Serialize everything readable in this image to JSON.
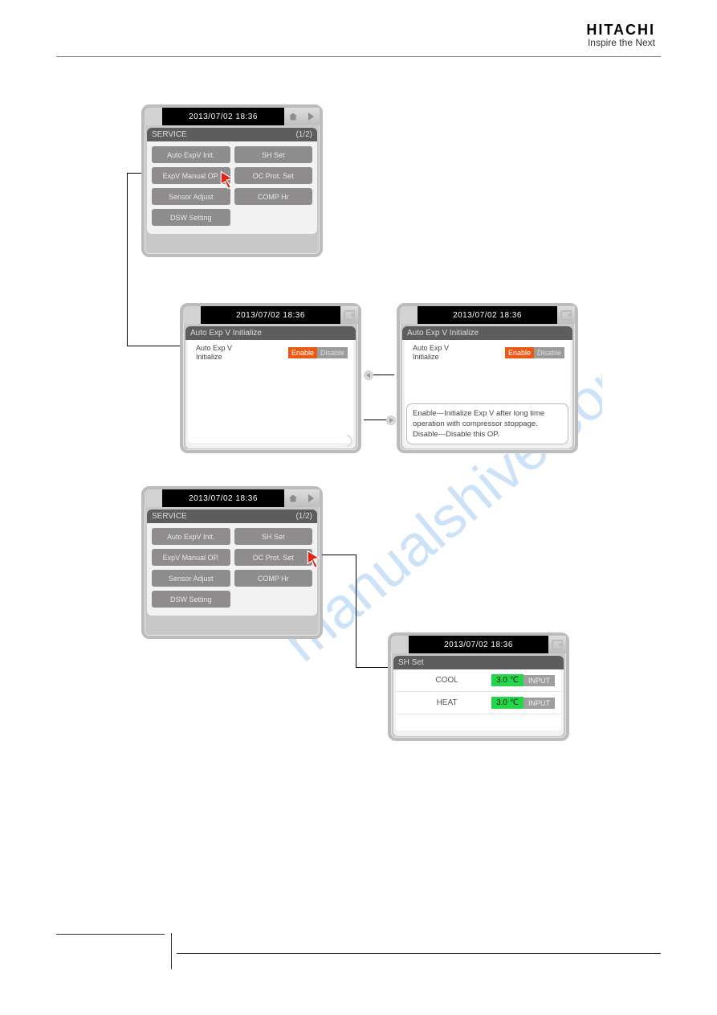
{
  "brand": {
    "logo": "HITACHI",
    "tagline": "Inspire the Next"
  },
  "watermark": "manualshive.com",
  "timestamp": "2013/07/02 18:36",
  "service_panel": {
    "title": "SERVICE",
    "page_indicator": "(1/2)",
    "buttons": [
      "Auto ExpV Init.",
      "SH Set",
      "ExpV Manual OP.",
      "OC Prot. Set",
      "Sensor Adjust",
      "COMP Hr",
      "DSW Setting"
    ]
  },
  "auto_expv": {
    "title": "Auto Exp V Initialize",
    "label": "Auto Exp V\nInitialize",
    "enable": "Enable",
    "disable": "Disable",
    "tooltip": "Enable---Initialize Exp V after long time operation with compressor stoppage.\nDisable---Disable this OP."
  },
  "sh_set": {
    "title": "SH Set",
    "rows": [
      {
        "mode": "COOL",
        "value": "3.0 ℃",
        "input": "INPUT"
      },
      {
        "mode": "HEAT",
        "value": "3.0 ℃",
        "input": "INPUT"
      }
    ]
  }
}
